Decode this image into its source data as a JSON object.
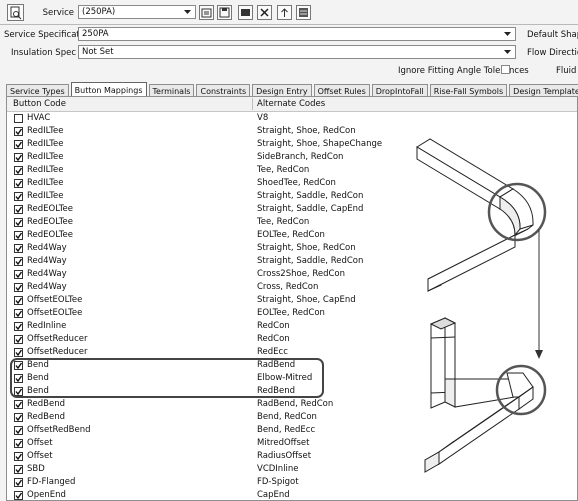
{
  "toolbar": {
    "service_label": "Service",
    "service_value": "(250PA)",
    "icons": [
      "service-editor-icon",
      "properties-icon",
      "save-icon",
      "screen-icon",
      "delete-icon",
      "move-up-icon",
      "database-icon"
    ]
  },
  "service_specification": {
    "label": "Service Specification",
    "value": "250PA"
  },
  "insulation_spec": {
    "label": "Insulation Spec",
    "value": "Not Set"
  },
  "ignore_fitting": {
    "label": "Ignore Fitting Angle Tolerances",
    "checked": false
  },
  "right_labels": {
    "default_shape": "Default Shape",
    "flow_direction": "Flow Direction",
    "fluid": "Fluid"
  },
  "tabs": [
    {
      "label": "Service Types",
      "active": false
    },
    {
      "label": "Button Mappings",
      "active": true
    },
    {
      "label": "Terminals",
      "active": false
    },
    {
      "label": "Constraints",
      "active": false
    },
    {
      "label": "Design Entry",
      "active": false
    },
    {
      "label": "Offset Rules",
      "active": false
    },
    {
      "label": "DropIntoFall",
      "active": false
    },
    {
      "label": "Rise-Fall Symbols",
      "active": false
    },
    {
      "label": "Design Templates",
      "active": false
    }
  ],
  "table": {
    "headers": {
      "code": "Button Code",
      "alt": "Alternate Codes"
    },
    "rows": [
      {
        "checked": false,
        "code": "HVAC",
        "alt": "V8"
      },
      {
        "checked": true,
        "code": "RedILTee",
        "alt": "Straight, Shoe, RedCon"
      },
      {
        "checked": true,
        "code": "RedILTee",
        "alt": "Straight, Shoe, ShapeChange"
      },
      {
        "checked": true,
        "code": "RedILTee",
        "alt": "SideBranch, RedCon"
      },
      {
        "checked": true,
        "code": "RedILTee",
        "alt": "Tee, RedCon"
      },
      {
        "checked": true,
        "code": "RedILTee",
        "alt": "ShoedTee, RedCon"
      },
      {
        "checked": true,
        "code": "RedILTee",
        "alt": "Straight, Saddle, RedCon"
      },
      {
        "checked": true,
        "code": "RedEOLTee",
        "alt": "Straight, Saddle, CapEnd"
      },
      {
        "checked": true,
        "code": "RedEOLTee",
        "alt": "Tee, RedCon"
      },
      {
        "checked": true,
        "code": "RedEOLTee",
        "alt": "EOLTee, RedCon"
      },
      {
        "checked": true,
        "code": "Red4Way",
        "alt": "Straight, Shoe, RedCon"
      },
      {
        "checked": true,
        "code": "Red4Way",
        "alt": "Straight, Saddle, RedCon"
      },
      {
        "checked": true,
        "code": "Red4Way",
        "alt": "Cross2Shoe, RedCon"
      },
      {
        "checked": true,
        "code": "Red4Way",
        "alt": "Cross, RedCon"
      },
      {
        "checked": true,
        "code": "OffsetEOLTee",
        "alt": "Straight, Shoe, CapEnd"
      },
      {
        "checked": true,
        "code": "OffsetEOLTee",
        "alt": "EOLTee, RedCon"
      },
      {
        "checked": true,
        "code": "RedInline",
        "alt": "RedCon"
      },
      {
        "checked": true,
        "code": "OffsetReducer",
        "alt": "RedCon"
      },
      {
        "checked": true,
        "code": "OffsetReducer",
        "alt": "RedEcc"
      },
      {
        "checked": true,
        "code": "Bend",
        "alt": "RadBend"
      },
      {
        "checked": true,
        "code": "Bend",
        "alt": "Elbow-Mitred"
      },
      {
        "checked": true,
        "code": "Bend",
        "alt": "RedBend"
      },
      {
        "checked": true,
        "code": "RedBend",
        "alt": "RadBend, RedCon"
      },
      {
        "checked": true,
        "code": "RedBend",
        "alt": "Bend, RedCon"
      },
      {
        "checked": true,
        "code": "OffsetRedBend",
        "alt": "Bend, RedEcc"
      },
      {
        "checked": true,
        "code": "Offset",
        "alt": "MitredOffset"
      },
      {
        "checked": true,
        "code": "Offset",
        "alt": "RadiusOffset"
      },
      {
        "checked": true,
        "code": "SBD",
        "alt": "VCDInline"
      },
      {
        "checked": true,
        "code": "FD-Flanged",
        "alt": "FD-Spigot"
      },
      {
        "checked": true,
        "code": "OpenEnd",
        "alt": "CapEnd"
      }
    ]
  }
}
